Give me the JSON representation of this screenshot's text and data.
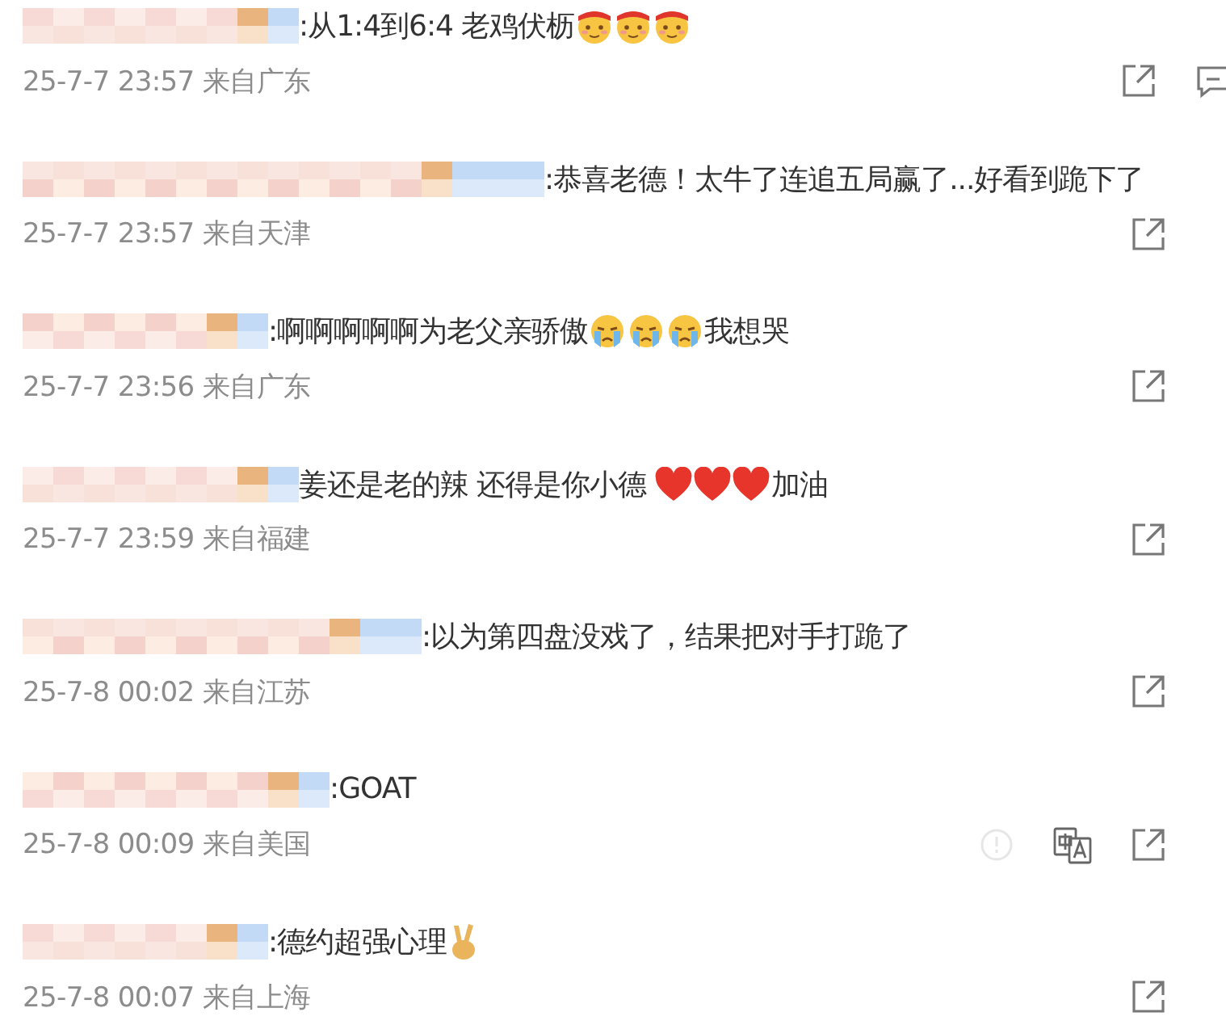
{
  "comments": [
    {
      "content": [
        {
          "kind": "text",
          "text": ":从1:4到6:4 老鸡伏枥"
        },
        {
          "kind": "blush"
        },
        {
          "kind": "blush"
        },
        {
          "kind": "blush"
        }
      ],
      "time": "25-7-7 23:57",
      "location": "来自广东",
      "actions": [
        {
          "kind": "share"
        },
        {
          "kind": "reply"
        }
      ]
    },
    {
      "content": [
        {
          "kind": "text",
          "text": ":恭喜老德！太牛了连追五局赢了...好看到跪下了"
        }
      ],
      "time": "25-7-7 23:57",
      "location": "来自天津",
      "actions": [
        {
          "kind": "share"
        }
      ]
    },
    {
      "content": [
        {
          "kind": "text",
          "text": ":啊啊啊啊啊为老父亲骄傲"
        },
        {
          "kind": "cry"
        },
        {
          "kind": "cry"
        },
        {
          "kind": "cry"
        },
        {
          "kind": "text",
          "text": "我想哭"
        }
      ],
      "time": "25-7-7 23:56",
      "location": "来自广东",
      "actions": [
        {
          "kind": "share"
        }
      ]
    },
    {
      "content": [
        {
          "kind": "text",
          "text": "姜还是老的辣 还得是你小德 "
        },
        {
          "kind": "heart"
        },
        {
          "kind": "heart"
        },
        {
          "kind": "heart"
        },
        {
          "kind": "text",
          "text": "加油"
        }
      ],
      "time": "25-7-7 23:59",
      "location": "来自福建",
      "actions": [
        {
          "kind": "share"
        }
      ]
    },
    {
      "content": [
        {
          "kind": "text",
          "text": ":以为第四盘没戏了，结果把对手打跪了"
        }
      ],
      "time": "25-7-8 00:02",
      "location": "来自江苏",
      "actions": [
        {
          "kind": "share"
        }
      ]
    },
    {
      "content": [
        {
          "kind": "text",
          "text": ":GOAT"
        }
      ],
      "time": "25-7-8 00:09",
      "location": "来自美国",
      "actions": [
        {
          "kind": "report"
        },
        {
          "kind": "translate"
        },
        {
          "kind": "share"
        }
      ]
    },
    {
      "content": [
        {
          "kind": "text",
          "text": ":德约超强心理"
        },
        {
          "kind": "victory"
        }
      ],
      "time": "25-7-8 00:07",
      "location": "来自上海",
      "actions": [
        {
          "kind": "share"
        }
      ]
    }
  ]
}
